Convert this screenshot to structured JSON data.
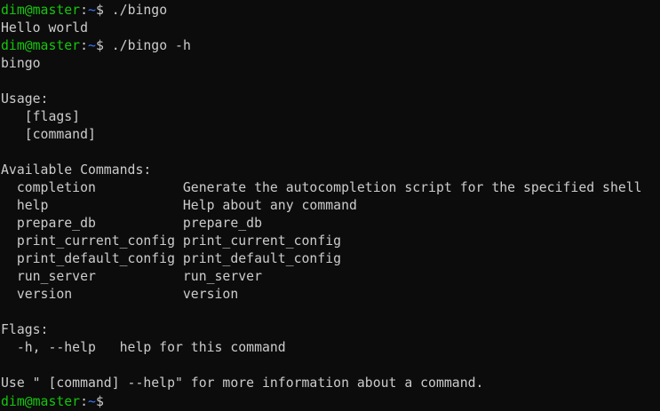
{
  "colors": {
    "background": "#0c0c0c",
    "text": "#cccccc",
    "prompt_user": "#16c60c",
    "prompt_path": "#3b78ff"
  },
  "prompt": {
    "user_host": "dim@master",
    "colon": ":",
    "path": "~",
    "dollar": "$"
  },
  "lines": [
    {
      "type": "prompt",
      "command": " ./bingo"
    },
    {
      "type": "output",
      "text": "Hello world"
    },
    {
      "type": "prompt",
      "command": " ./bingo -h"
    },
    {
      "type": "output",
      "text": "bingo"
    },
    {
      "type": "output",
      "text": ""
    },
    {
      "type": "output",
      "text": "Usage:"
    },
    {
      "type": "output",
      "text": "   [flags]"
    },
    {
      "type": "output",
      "text": "   [command]"
    },
    {
      "type": "output",
      "text": ""
    },
    {
      "type": "output",
      "text": "Available Commands:"
    },
    {
      "type": "output",
      "text": "  completion           Generate the autocompletion script for the specified shell"
    },
    {
      "type": "output",
      "text": "  help                 Help about any command"
    },
    {
      "type": "output",
      "text": "  prepare_db           prepare_db"
    },
    {
      "type": "output",
      "text": "  print_current_config print_current_config"
    },
    {
      "type": "output",
      "text": "  print_default_config print_default_config"
    },
    {
      "type": "output",
      "text": "  run_server           run_server"
    },
    {
      "type": "output",
      "text": "  version              version"
    },
    {
      "type": "output",
      "text": ""
    },
    {
      "type": "output",
      "text": "Flags:"
    },
    {
      "type": "output",
      "text": "  -h, --help   help for this command"
    },
    {
      "type": "output",
      "text": ""
    },
    {
      "type": "output",
      "text": "Use \" [command] --help\" for more information about a command."
    },
    {
      "type": "prompt",
      "command": ""
    }
  ]
}
